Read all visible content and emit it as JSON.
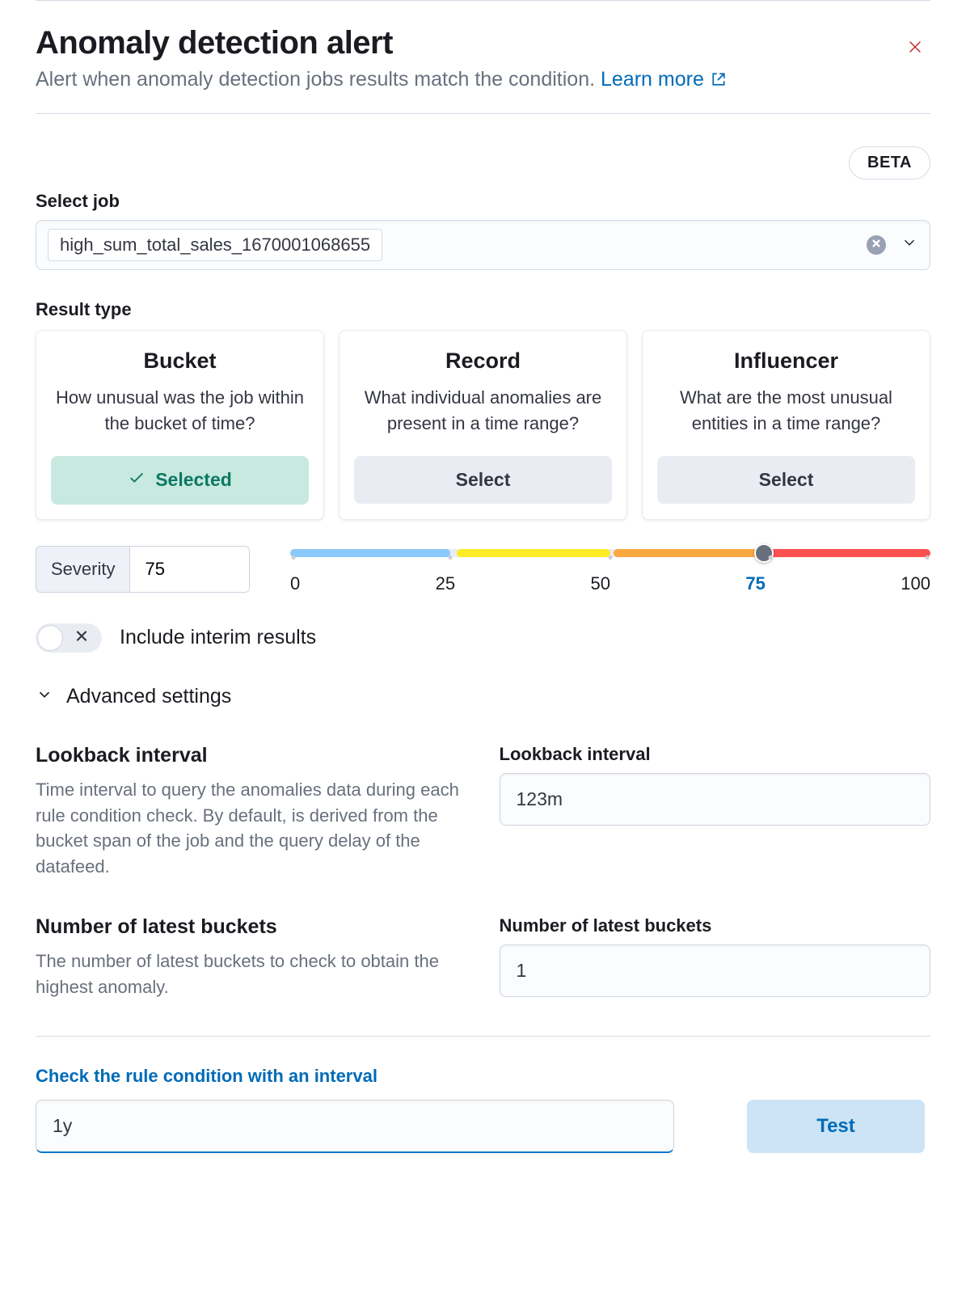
{
  "header": {
    "title": "Anomaly detection alert",
    "subtitle": "Alert when anomaly detection jobs results match the condition.",
    "learn_more": "Learn more"
  },
  "beta_label": "BETA",
  "select_job": {
    "label": "Select job",
    "value": "high_sum_total_sales_1670001068655"
  },
  "result_type": {
    "label": "Result type",
    "cards": [
      {
        "title": "Bucket",
        "desc": "How unusual was the job within the bucket of time?",
        "selected": true,
        "btn": "Selected"
      },
      {
        "title": "Record",
        "desc": "What individual anomalies are present in a time range?",
        "selected": false,
        "btn": "Select"
      },
      {
        "title": "Influencer",
        "desc": "What are the most unusual entities in a time range?",
        "selected": false,
        "btn": "Select"
      }
    ]
  },
  "severity": {
    "label": "Severity",
    "value": "75",
    "ticks": [
      "0",
      "25",
      "50",
      "75",
      "100"
    ]
  },
  "interim": {
    "label": "Include interim results",
    "on": false
  },
  "advanced_label": "Advanced settings",
  "lookback": {
    "title": "Lookback interval",
    "desc": "Time interval to query the anomalies data during each rule condition check. By default, is derived from the bucket span of the job and the query delay of the datafeed.",
    "input_label": "Lookback interval",
    "value": "123m"
  },
  "buckets": {
    "title": "Number of latest buckets",
    "desc": "The number of latest buckets to check to obtain the highest anomaly.",
    "input_label": "Number of latest buckets",
    "value": "1"
  },
  "check": {
    "title": "Check the rule condition with an interval",
    "value": "1y",
    "test_btn": "Test"
  }
}
